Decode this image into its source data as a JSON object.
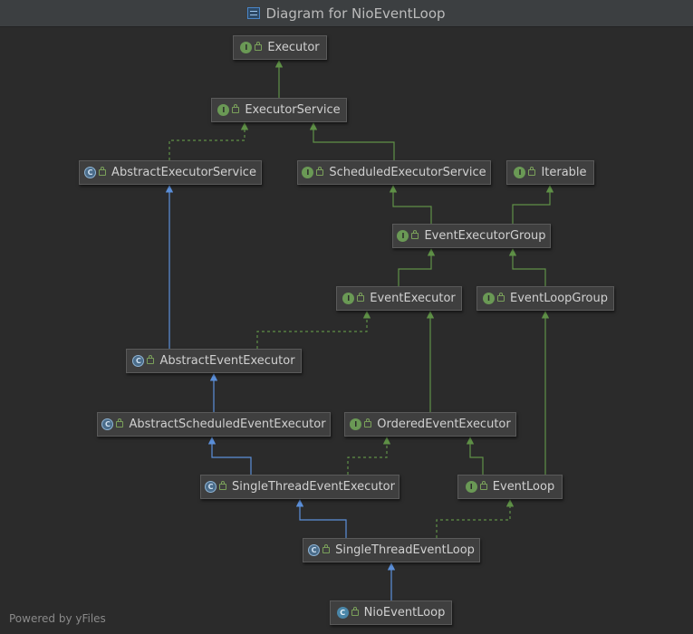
{
  "window": {
    "title": "Diagram for NioEventLoop"
  },
  "footer": {
    "text": "Powered by yFiles"
  },
  "colors": {
    "background": "#2b2b2b",
    "node_fill": "#3f3f3f",
    "interface_badge": "#6a9955",
    "class_badge": "#4a86a8",
    "implements_edge": "#5f9147",
    "extends_edge": "#5b8fd9"
  },
  "diagram": {
    "nodes": [
      {
        "id": "executor",
        "label": "Executor",
        "kind": "interface"
      },
      {
        "id": "executor_service",
        "label": "ExecutorService",
        "kind": "interface"
      },
      {
        "id": "abstract_executor_service",
        "label": "AbstractExecutorService",
        "kind": "abstract-class"
      },
      {
        "id": "scheduled_executor_service",
        "label": "ScheduledExecutorService",
        "kind": "interface"
      },
      {
        "id": "iterable",
        "label": "Iterable",
        "kind": "interface"
      },
      {
        "id": "event_executor_group",
        "label": "EventExecutorGroup",
        "kind": "interface"
      },
      {
        "id": "event_executor",
        "label": "EventExecutor",
        "kind": "interface"
      },
      {
        "id": "event_loop_group",
        "label": "EventLoopGroup",
        "kind": "interface"
      },
      {
        "id": "abstract_event_executor",
        "label": "AbstractEventExecutor",
        "kind": "abstract-class"
      },
      {
        "id": "abstract_scheduled_event_executor",
        "label": "AbstractScheduledEventExecutor",
        "kind": "abstract-class"
      },
      {
        "id": "ordered_event_executor",
        "label": "OrderedEventExecutor",
        "kind": "interface"
      },
      {
        "id": "single_thread_event_executor",
        "label": "SingleThreadEventExecutor",
        "kind": "abstract-class"
      },
      {
        "id": "event_loop",
        "label": "EventLoop",
        "kind": "interface"
      },
      {
        "id": "single_thread_event_loop",
        "label": "SingleThreadEventLoop",
        "kind": "abstract-class"
      },
      {
        "id": "nio_event_loop",
        "label": "NioEventLoop",
        "kind": "class"
      }
    ],
    "edges": [
      {
        "from": "executor_service",
        "to": "executor",
        "relation": "extends-interface"
      },
      {
        "from": "abstract_executor_service",
        "to": "executor_service",
        "relation": "implements"
      },
      {
        "from": "scheduled_executor_service",
        "to": "executor_service",
        "relation": "extends-interface"
      },
      {
        "from": "event_executor_group",
        "to": "scheduled_executor_service",
        "relation": "extends-interface"
      },
      {
        "from": "event_executor_group",
        "to": "iterable",
        "relation": "extends-interface"
      },
      {
        "from": "event_executor",
        "to": "event_executor_group",
        "relation": "extends-interface"
      },
      {
        "from": "event_loop_group",
        "to": "event_executor_group",
        "relation": "extends-interface"
      },
      {
        "from": "abstract_event_executor",
        "to": "abstract_executor_service",
        "relation": "extends-class"
      },
      {
        "from": "abstract_event_executor",
        "to": "event_executor",
        "relation": "implements"
      },
      {
        "from": "abstract_scheduled_event_executor",
        "to": "abstract_event_executor",
        "relation": "extends-class"
      },
      {
        "from": "ordered_event_executor",
        "to": "event_executor",
        "relation": "extends-interface"
      },
      {
        "from": "single_thread_event_executor",
        "to": "abstract_scheduled_event_executor",
        "relation": "extends-class"
      },
      {
        "from": "single_thread_event_executor",
        "to": "ordered_event_executor",
        "relation": "implements"
      },
      {
        "from": "event_loop",
        "to": "ordered_event_executor",
        "relation": "extends-interface"
      },
      {
        "from": "event_loop",
        "to": "event_loop_group",
        "relation": "extends-interface"
      },
      {
        "from": "single_thread_event_loop",
        "to": "single_thread_event_executor",
        "relation": "extends-class"
      },
      {
        "from": "single_thread_event_loop",
        "to": "event_loop",
        "relation": "implements"
      },
      {
        "from": "nio_event_loop",
        "to": "single_thread_event_loop",
        "relation": "extends-class"
      }
    ]
  }
}
